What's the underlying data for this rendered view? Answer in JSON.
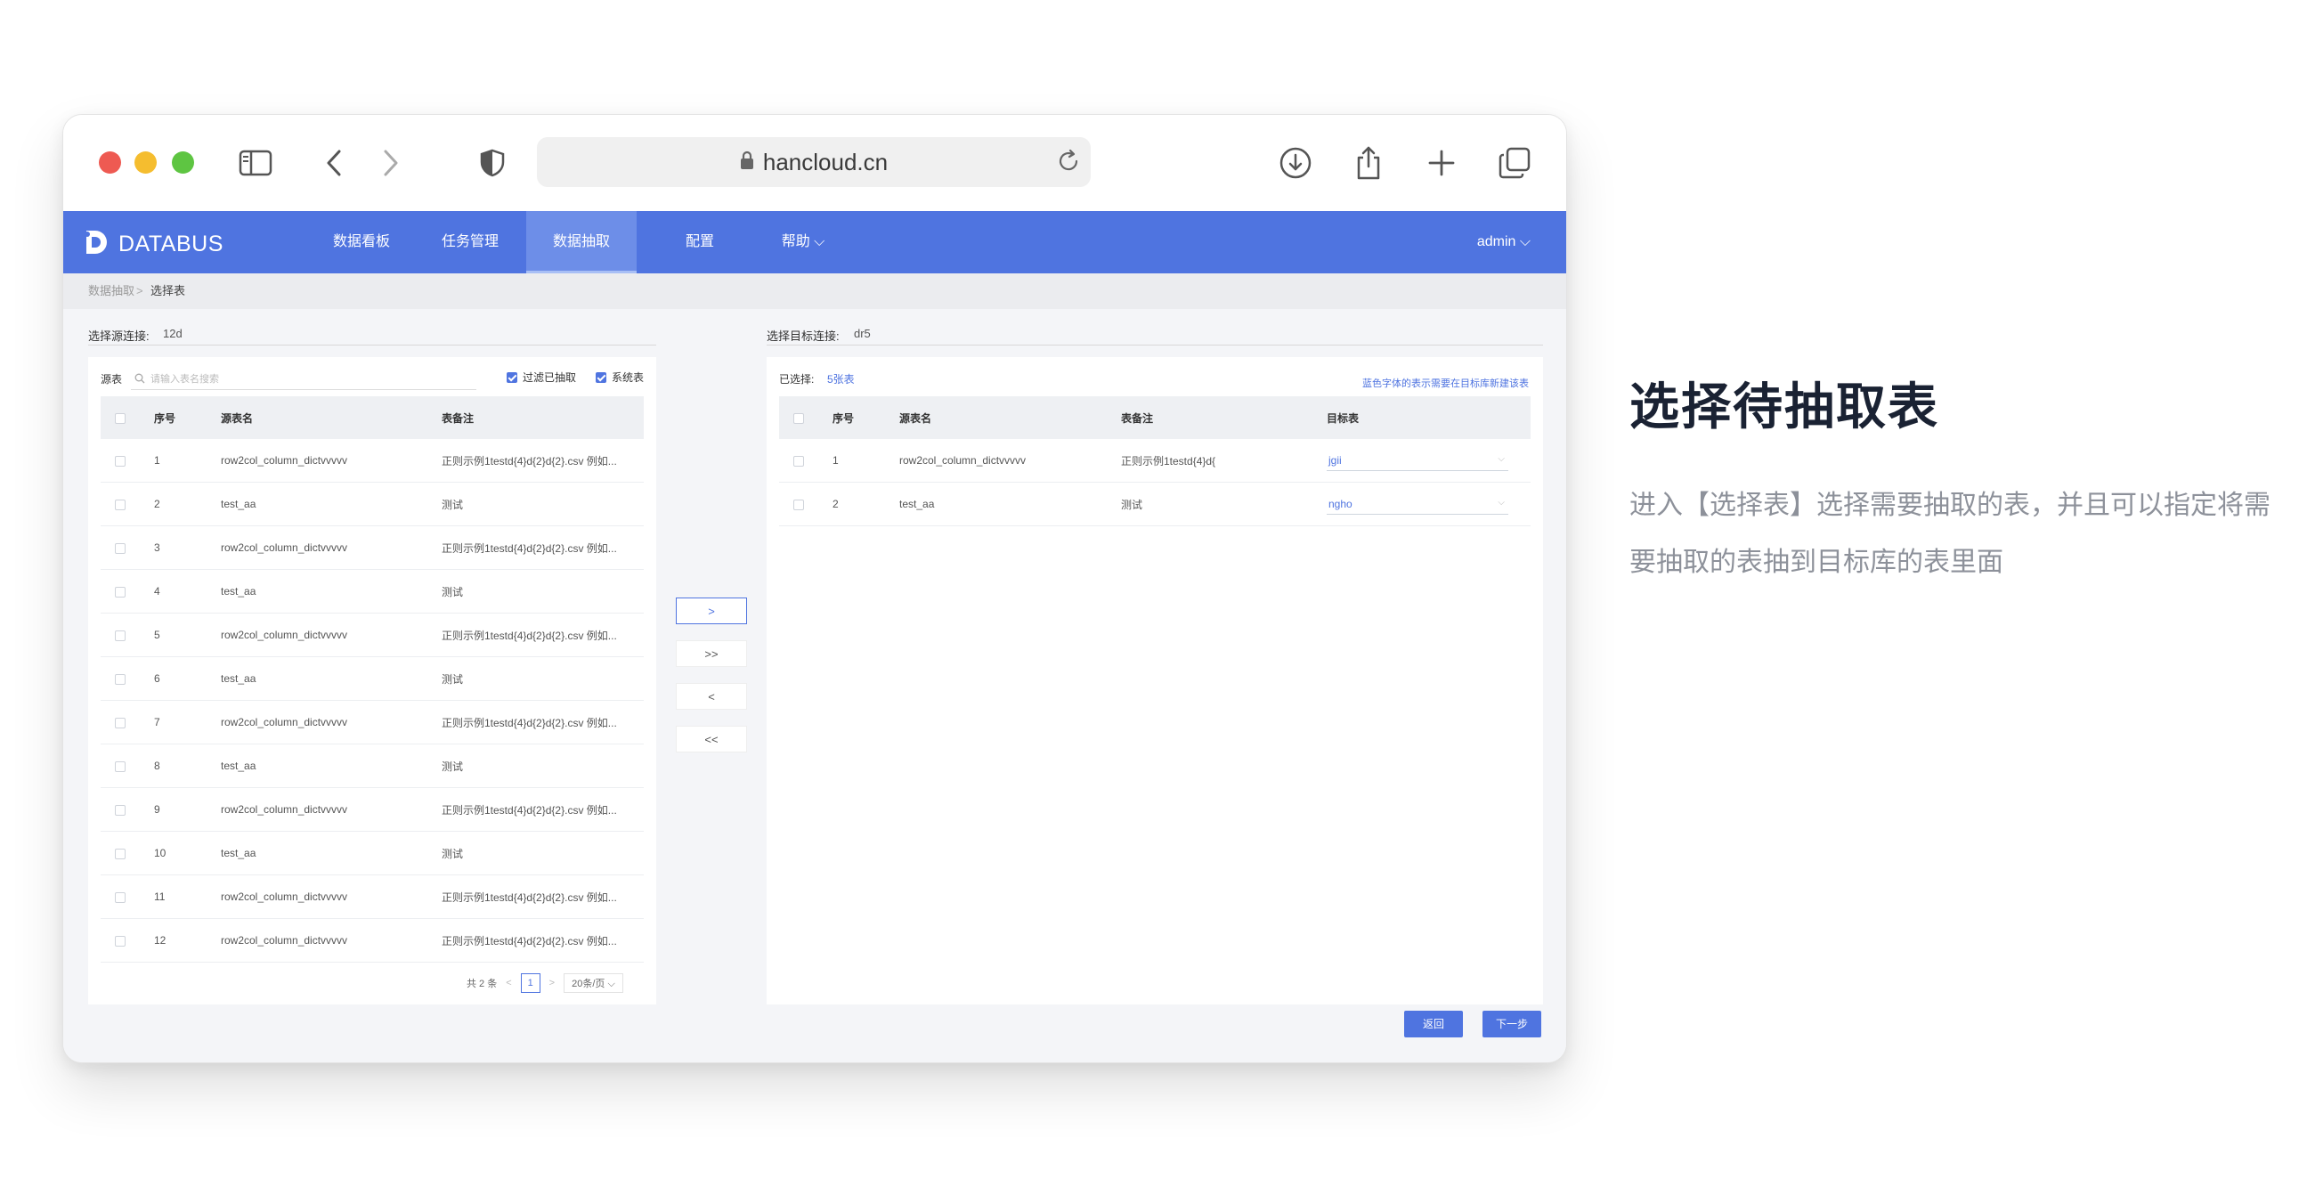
{
  "browser": {
    "url": "hancloud.cn"
  },
  "app": {
    "logo": "DATABUS",
    "nav": [
      {
        "label": "数据看板"
      },
      {
        "label": "任务管理"
      },
      {
        "label": "数据抽取"
      },
      {
        "label": "配置"
      },
      {
        "label": "帮助 ⌵"
      }
    ],
    "active_nav": "数据抽取",
    "user": "admin ⌵"
  },
  "breadcrumb": {
    "parent": "数据抽取",
    "separator": ">",
    "current": "选择表"
  },
  "source": {
    "label": "选择源连接:",
    "value": "12d"
  },
  "target": {
    "label": "选择目标连接:",
    "value": "dr5"
  },
  "left_panel": {
    "source_label": "源表",
    "search_placeholder": "请输入表名搜索",
    "filter_extracted": "过滤已抽取",
    "system_table": "系统表",
    "headers": [
      "序号",
      "源表名",
      "表备注"
    ],
    "rows": [
      [
        "1",
        "row2col_column_dictvvvvv",
        "正则示例1testd{4}d{2}d{2}.csv 例如..."
      ],
      [
        "2",
        "test_aa",
        "测试"
      ],
      [
        "3",
        "row2col_column_dictvvvvv",
        "正则示例1testd{4}d{2}d{2}.csv 例如..."
      ],
      [
        "4",
        "test_aa",
        "测试"
      ],
      [
        "5",
        "row2col_column_dictvvvvv",
        "正则示例1testd{4}d{2}d{2}.csv 例如..."
      ],
      [
        "6",
        "test_aa",
        "测试"
      ],
      [
        "7",
        "row2col_column_dictvvvvv",
        "正则示例1testd{4}d{2}d{2}.csv 例如..."
      ],
      [
        "8",
        "test_aa",
        "测试"
      ],
      [
        "9",
        "row2col_column_dictvvvvv",
        "正则示例1testd{4}d{2}d{2}.csv 例如..."
      ],
      [
        "10",
        "test_aa",
        "测试"
      ],
      [
        "11",
        "row2col_column_dictvvvvv",
        "正则示例1testd{4}d{2}d{2}.csv 例如..."
      ],
      [
        "12",
        "row2col_column_dictvvvvv",
        "正则示例1testd{4}d{2}d{2}.csv 例如..."
      ]
    ],
    "pager": {
      "total": "共 2 条",
      "page": "1",
      "page_size": "20条/页 ⌵"
    }
  },
  "transfer_buttons": [
    ">",
    ">>",
    "<",
    "<<"
  ],
  "right_panel": {
    "selected_label": "已选择:",
    "selected_value": "5张表",
    "hint": "蓝色字体的表示需要在目标库新建该表",
    "headers": [
      "序号",
      "源表名",
      "表备注",
      "目标表"
    ],
    "rows": [
      [
        "1",
        "row2col_column_dictvvvvv",
        "正则示例1testd{4}d{",
        "jgii"
      ],
      [
        "2",
        "test_aa",
        "测试",
        "ngho"
      ]
    ]
  },
  "actions": {
    "back": "返回",
    "next": "下一步"
  },
  "description": {
    "title": "选择待抽取表",
    "line1": "进入【选择表】选择需要抽取的表，并且可以指定将需",
    "line2": "要抽取的表抽到目标库的表里面"
  },
  "colors": {
    "primary": "#4f74e0",
    "nav_active": "#6d8ee8"
  }
}
